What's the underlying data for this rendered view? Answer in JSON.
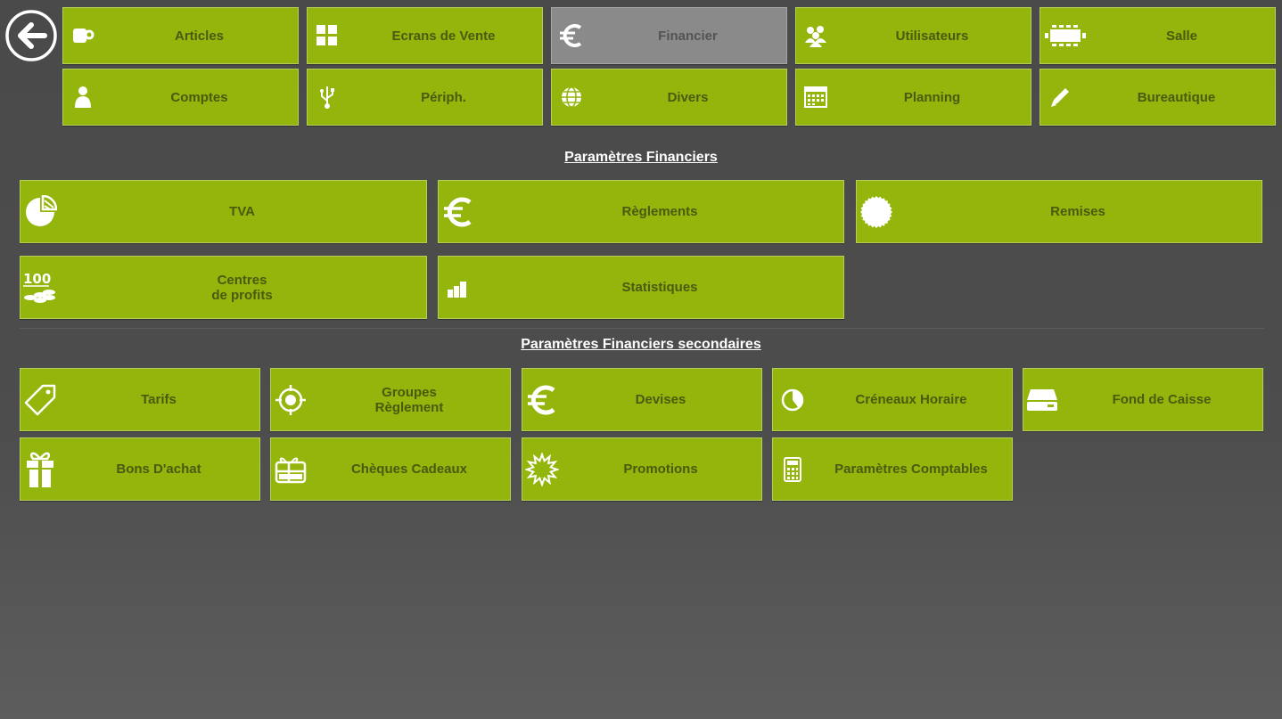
{
  "nav": {
    "back_icon": "arrow-left-circle-icon",
    "row1": [
      {
        "label": "Articles",
        "icon": "cup-icon"
      },
      {
        "label": "Ecrans de Vente",
        "icon": "grid-icon"
      },
      {
        "label": "Financier",
        "icon": "euro-icon",
        "active": true
      },
      {
        "label": "Utilisateurs",
        "icon": "users-icon"
      },
      {
        "label": "Salle",
        "icon": "table-icon"
      }
    ],
    "row2": [
      {
        "label": "Comptes",
        "icon": "user-icon"
      },
      {
        "label": "Périph.",
        "icon": "usb-icon"
      },
      {
        "label": "Divers",
        "icon": "globe-icon"
      },
      {
        "label": "Planning",
        "icon": "calendar-icon"
      },
      {
        "label": "Bureautique",
        "icon": "pencil-icon"
      }
    ]
  },
  "section1": {
    "title": "Paramètres Financiers",
    "tiles": [
      {
        "label": "TVA",
        "icon": "pie-chart-icon"
      },
      {
        "label": "Règlements",
        "icon": "euro-icon"
      },
      {
        "label": "Remises",
        "icon": "badge-icon"
      },
      {
        "label": "Centres\nde profits",
        "icon": "coins-icon"
      },
      {
        "label": "Statistiques",
        "icon": "bar-chart-icon"
      }
    ]
  },
  "section2": {
    "title": "Paramètres Financiers secondaires",
    "tiles": [
      {
        "label": "Tarifs",
        "icon": "tag-icon"
      },
      {
        "label": "Groupes\nRèglement",
        "icon": "target-icon"
      },
      {
        "label": "Devises",
        "icon": "euro-icon"
      },
      {
        "label": "Créneaux Horaire",
        "icon": "clock-pie-icon"
      },
      {
        "label": "Fond de Caisse",
        "icon": "cash-drawer-icon"
      },
      {
        "label": "Bons D'achat",
        "icon": "gift-icon"
      },
      {
        "label": "Chèques Cadeaux",
        "icon": "gift-card-icon"
      },
      {
        "label": "Promotions",
        "icon": "starburst-icon"
      },
      {
        "label": "Paramètres Comptables",
        "icon": "calculator-icon"
      }
    ]
  },
  "colors": {
    "tile_green": "#94b50b",
    "tile_active": "#8a8a8a",
    "background": "#4a4a4a"
  }
}
